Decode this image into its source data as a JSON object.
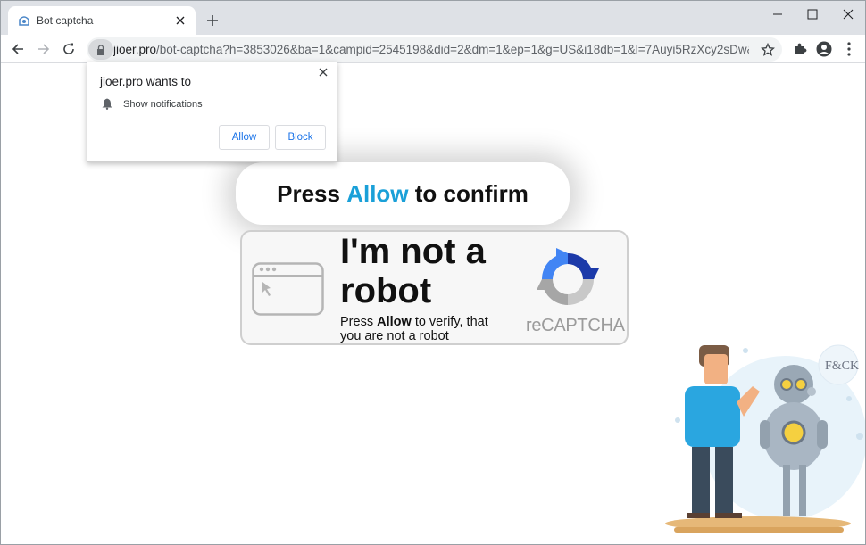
{
  "tab": {
    "title": "Bot captcha"
  },
  "toolbar": {
    "url_host": "jioer.pro",
    "url_path": "/bot-captcha?h=3853026&ba=1&campid=2545198&did=2&dm=1&ep=1&g=US&i18db=1&l=7Auyi5RzXcy2sDw&oaid=..."
  },
  "permission_popup": {
    "title": "jioer.pro wants to",
    "item": "Show notifications",
    "allow_label": "Allow",
    "block_label": "Block"
  },
  "banner": {
    "before": "Press",
    "highlight": "Allow",
    "after": "to confirm"
  },
  "captcha": {
    "title": "I'm not a robot",
    "sub_before": "Press",
    "sub_bold": "Allow",
    "sub_after": "to verify, that you are not a robot",
    "brand": "reCAPTCHA"
  },
  "illustration": {
    "badge": "F&CK"
  },
  "colors": {
    "accent": "#1aa0d8",
    "link_blue": "#1a73e8"
  }
}
